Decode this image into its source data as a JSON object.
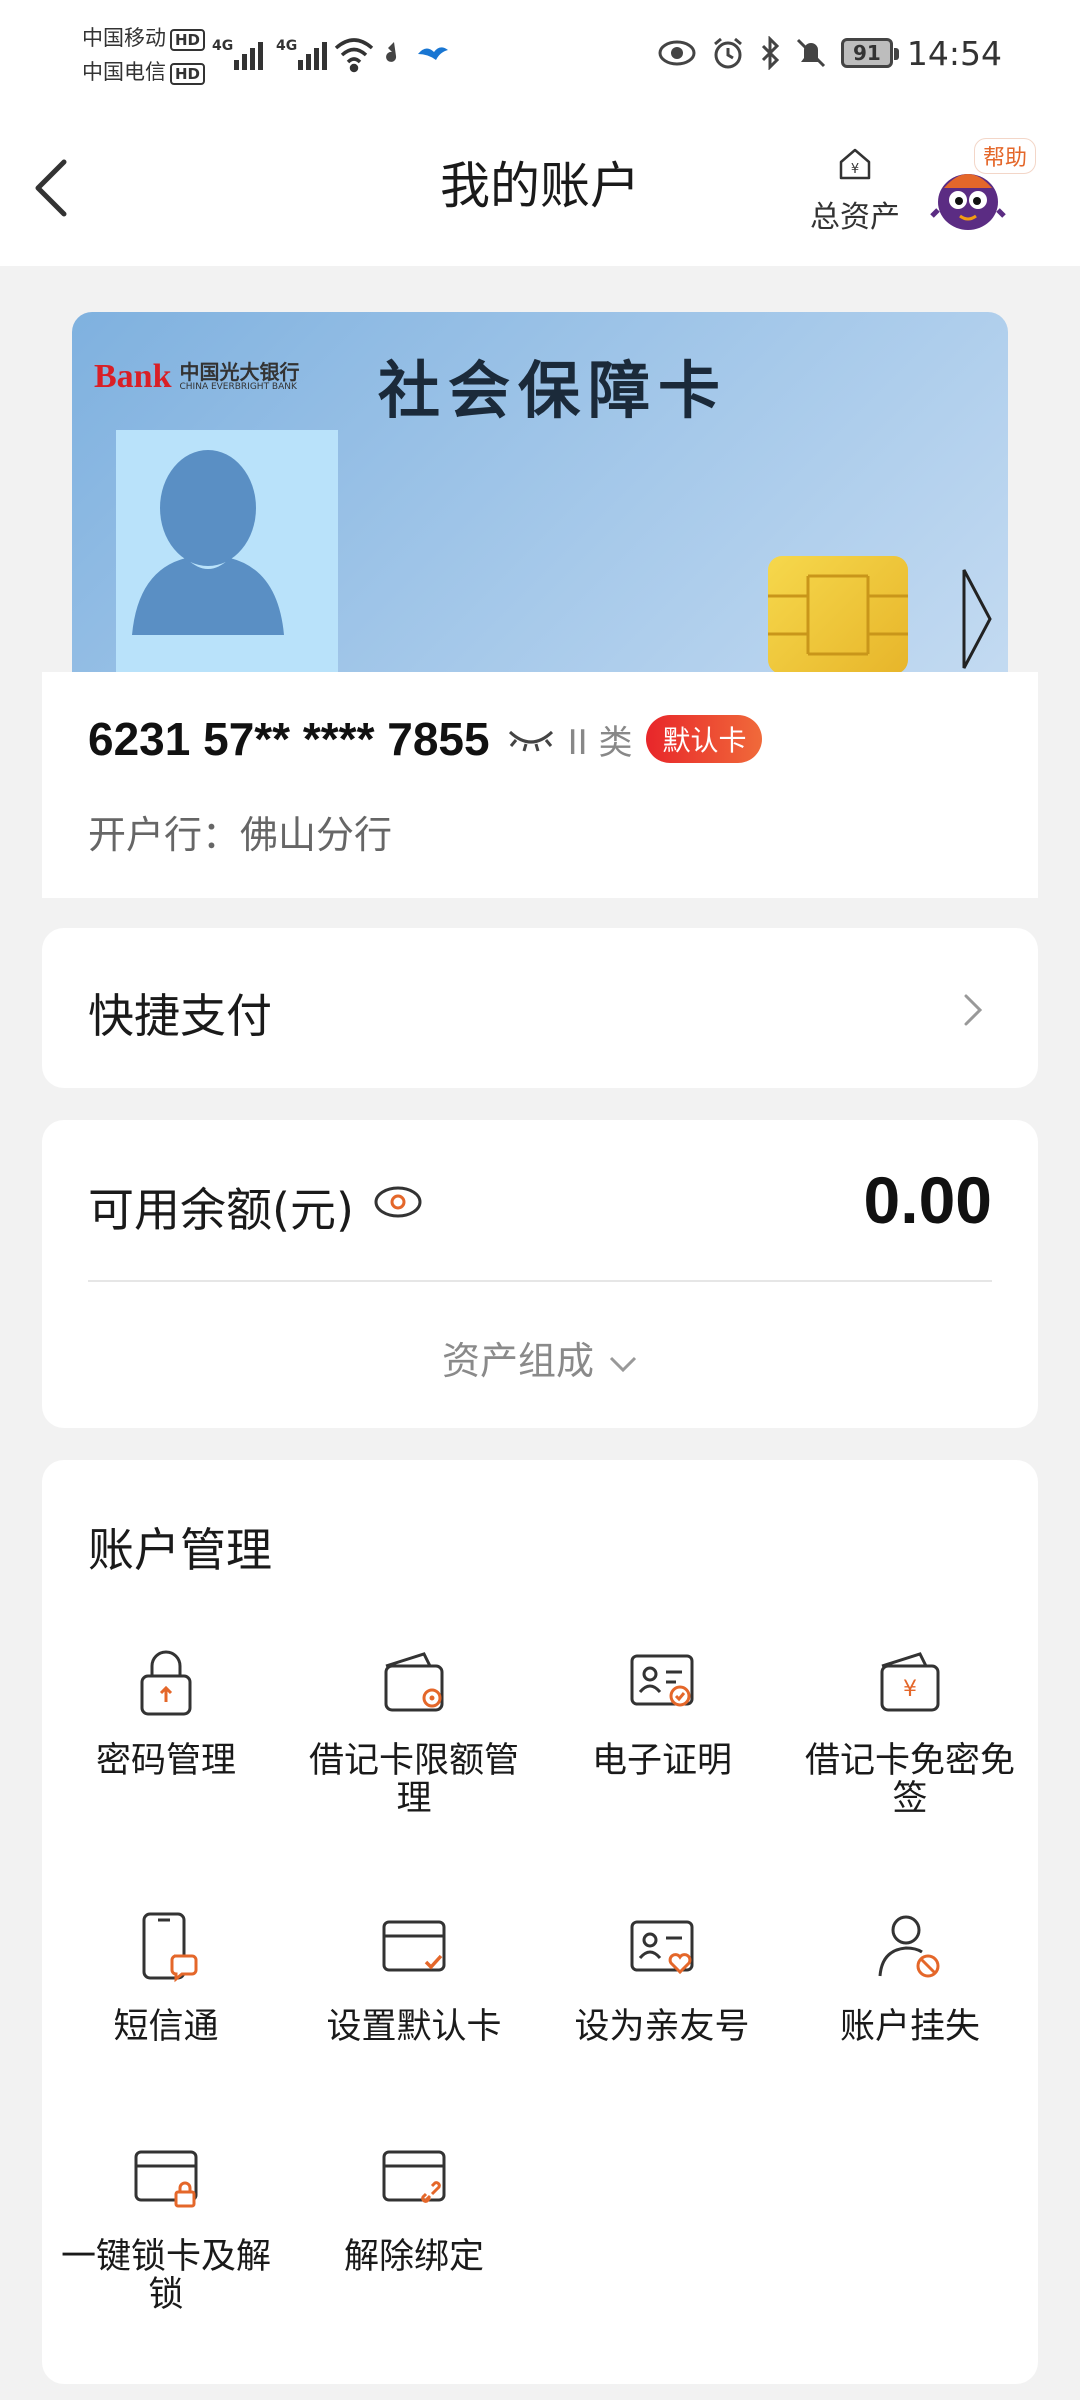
{
  "status_bar": {
    "carrier1": "中国移动",
    "carrier2": "中国电信",
    "hd": "HD",
    "net1": "4G",
    "net2": "4G",
    "battery": "91",
    "time": "14:54"
  },
  "nav": {
    "title": "我的账户",
    "assets_label": "总资产",
    "help_label": "帮助"
  },
  "card": {
    "title": "社会保障卡",
    "bank_cn": "中国光大银行",
    "bank_en": "CHINA EVERBRIGHT BANK",
    "bank_mark": "Bank"
  },
  "account": {
    "number": "6231 57** **** 7855",
    "class": "II 类",
    "default_badge": "默认卡",
    "branch": "开户行：佛山分行"
  },
  "quick_pay": {
    "label": "快捷支付"
  },
  "balance": {
    "label": "可用余额(元)",
    "amount": "0.00",
    "composition": "资产组成"
  },
  "management": {
    "heading": "账户管理",
    "items": [
      {
        "label": "密码管理",
        "icon": "lock-icon"
      },
      {
        "label": "借记卡限额管理",
        "icon": "wallet-limit-icon"
      },
      {
        "label": "电子证明",
        "icon": "id-card-check-icon"
      },
      {
        "label": "借记卡免密免签",
        "icon": "wallet-yen-icon"
      },
      {
        "label": "短信通",
        "icon": "phone-message-icon"
      },
      {
        "label": "设置默认卡",
        "icon": "card-check-icon"
      },
      {
        "label": "设为亲友号",
        "icon": "id-card-heart-icon"
      },
      {
        "label": "账户挂失",
        "icon": "user-block-icon"
      },
      {
        "label": "一键锁卡及解锁",
        "icon": "card-lock-icon"
      },
      {
        "label": "解除绑定",
        "icon": "card-unlink-icon"
      }
    ]
  },
  "colors": {
    "accent": "#e4672a",
    "badge_red": "#e8262a",
    "background": "#f2f2f2"
  }
}
